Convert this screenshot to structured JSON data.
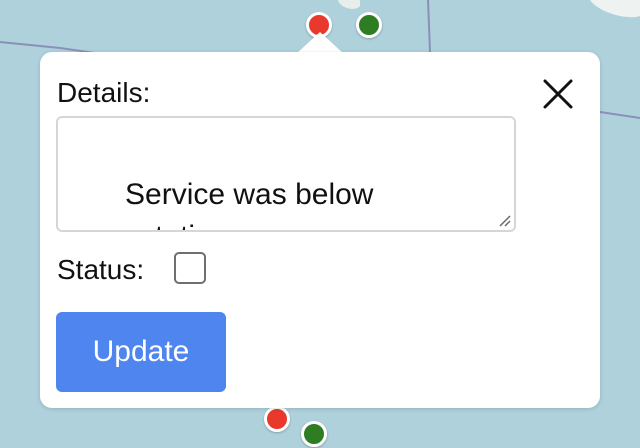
{
  "map": {
    "water_color": "#aed1dc",
    "markers": [
      {
        "name": "marker-red-top",
        "color": "#e8392c"
      },
      {
        "name": "marker-green-top",
        "color": "#2f7d23"
      },
      {
        "name": "marker-red-bottom",
        "color": "#e8392c"
      },
      {
        "name": "marker-green-bottom",
        "color": "#2f7d23"
      }
    ]
  },
  "popup": {
    "details_label": "Details:",
    "details_value": "Service was below expectations.",
    "status_label": "Status:",
    "status_checked": false,
    "update_label": "Update",
    "close_icon": "close-icon",
    "accent_color": "#4f85ef"
  }
}
